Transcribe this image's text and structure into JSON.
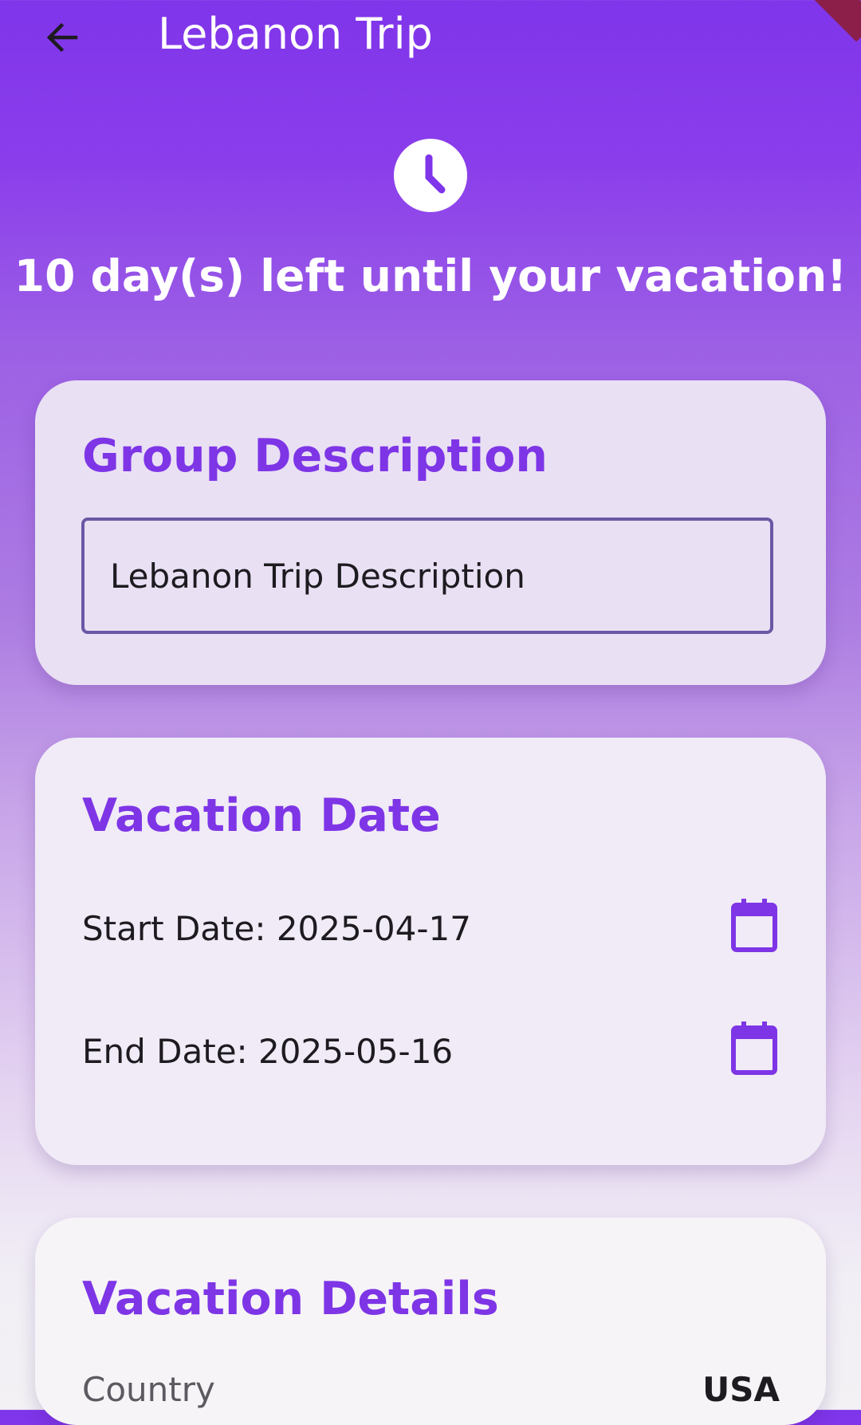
{
  "app": {
    "title": "Lebanon Trip",
    "back_icon": "arrow-back-icon"
  },
  "header": {
    "icon": "clock-icon",
    "countdown_text": "10 day(s) left until your vacation!"
  },
  "group_description": {
    "heading": "Group Description",
    "value": "Lebanon Trip Description"
  },
  "vacation_date": {
    "heading": "Vacation Date",
    "start_label": "Start Date: 2025-04-17",
    "end_label": "End Date: 2025-05-16",
    "calendar_icon": "calendar-icon"
  },
  "vacation_details": {
    "heading": "Vacation Details",
    "rows": [
      {
        "label": "Country",
        "value": "USA"
      }
    ]
  },
  "colors": {
    "accent": "#7e35e6",
    "appbar": "#7f35ea",
    "field_border": "#6a58a5"
  }
}
